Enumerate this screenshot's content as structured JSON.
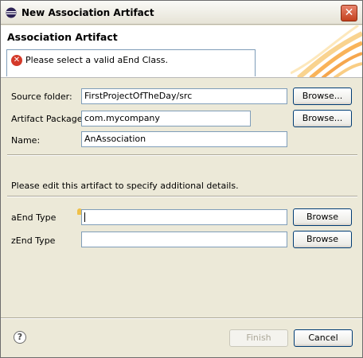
{
  "window": {
    "title": "New Association Artifact",
    "close_glyph": "✕"
  },
  "banner": {
    "heading": "Association Artifact",
    "error_message": "Please select a valid aEnd Class."
  },
  "form": {
    "source_folder": {
      "label": "Source folder:",
      "value": "FirstProjectOfTheDay/src",
      "browse": "Browse..."
    },
    "artifact_package": {
      "label": "Artifact Package:",
      "value": "com.mycompany",
      "browse": "Browse..."
    },
    "name": {
      "label": "Name:",
      "value": "AnAssociation"
    },
    "details_text": "Please edit this artifact to specify additional details.",
    "aend_type": {
      "label": "aEnd Type",
      "value": "",
      "browse": "Browse"
    },
    "zend_type": {
      "label": "zEnd Type",
      "value": "",
      "browse": "Browse"
    }
  },
  "footer": {
    "help_glyph": "?",
    "finish": "Finish",
    "cancel": "Cancel"
  },
  "icons": {
    "app": "eclipse-icon",
    "close": "close-icon",
    "error": "error-icon",
    "help": "help-icon",
    "content_assist": "lightbulb-icon"
  },
  "colors": {
    "error": "#d43a2a",
    "banner_accent": "#f7a030",
    "window_bg": "#ece9d8"
  }
}
